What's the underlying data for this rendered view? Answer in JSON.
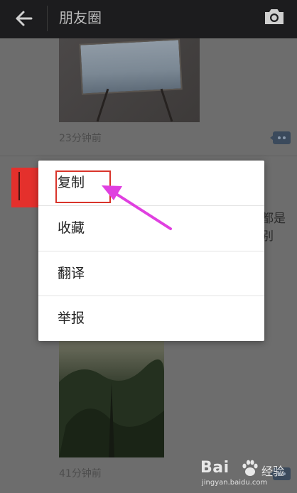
{
  "topbar": {
    "title": "朋友圈",
    "back_icon": "arrow-left-icon",
    "camera_icon": "camera-icon"
  },
  "feed": {
    "post1": {
      "time": "23分钟前"
    },
    "post2": {
      "text_fragment_line1": "都是",
      "text_fragment_line2": "别"
    },
    "post3": {
      "time": "41分钟前"
    }
  },
  "context_menu": {
    "items": [
      {
        "label": "复制"
      },
      {
        "label": "收藏"
      },
      {
        "label": "翻译"
      },
      {
        "label": "举报"
      }
    ]
  },
  "annotation": {
    "highlight_color": "#d9342b",
    "arrow_color": "#e040e0"
  },
  "watermark": {
    "brand": "Bai",
    "brand_cn": "经验",
    "url": "jingyan.baidu.com"
  }
}
